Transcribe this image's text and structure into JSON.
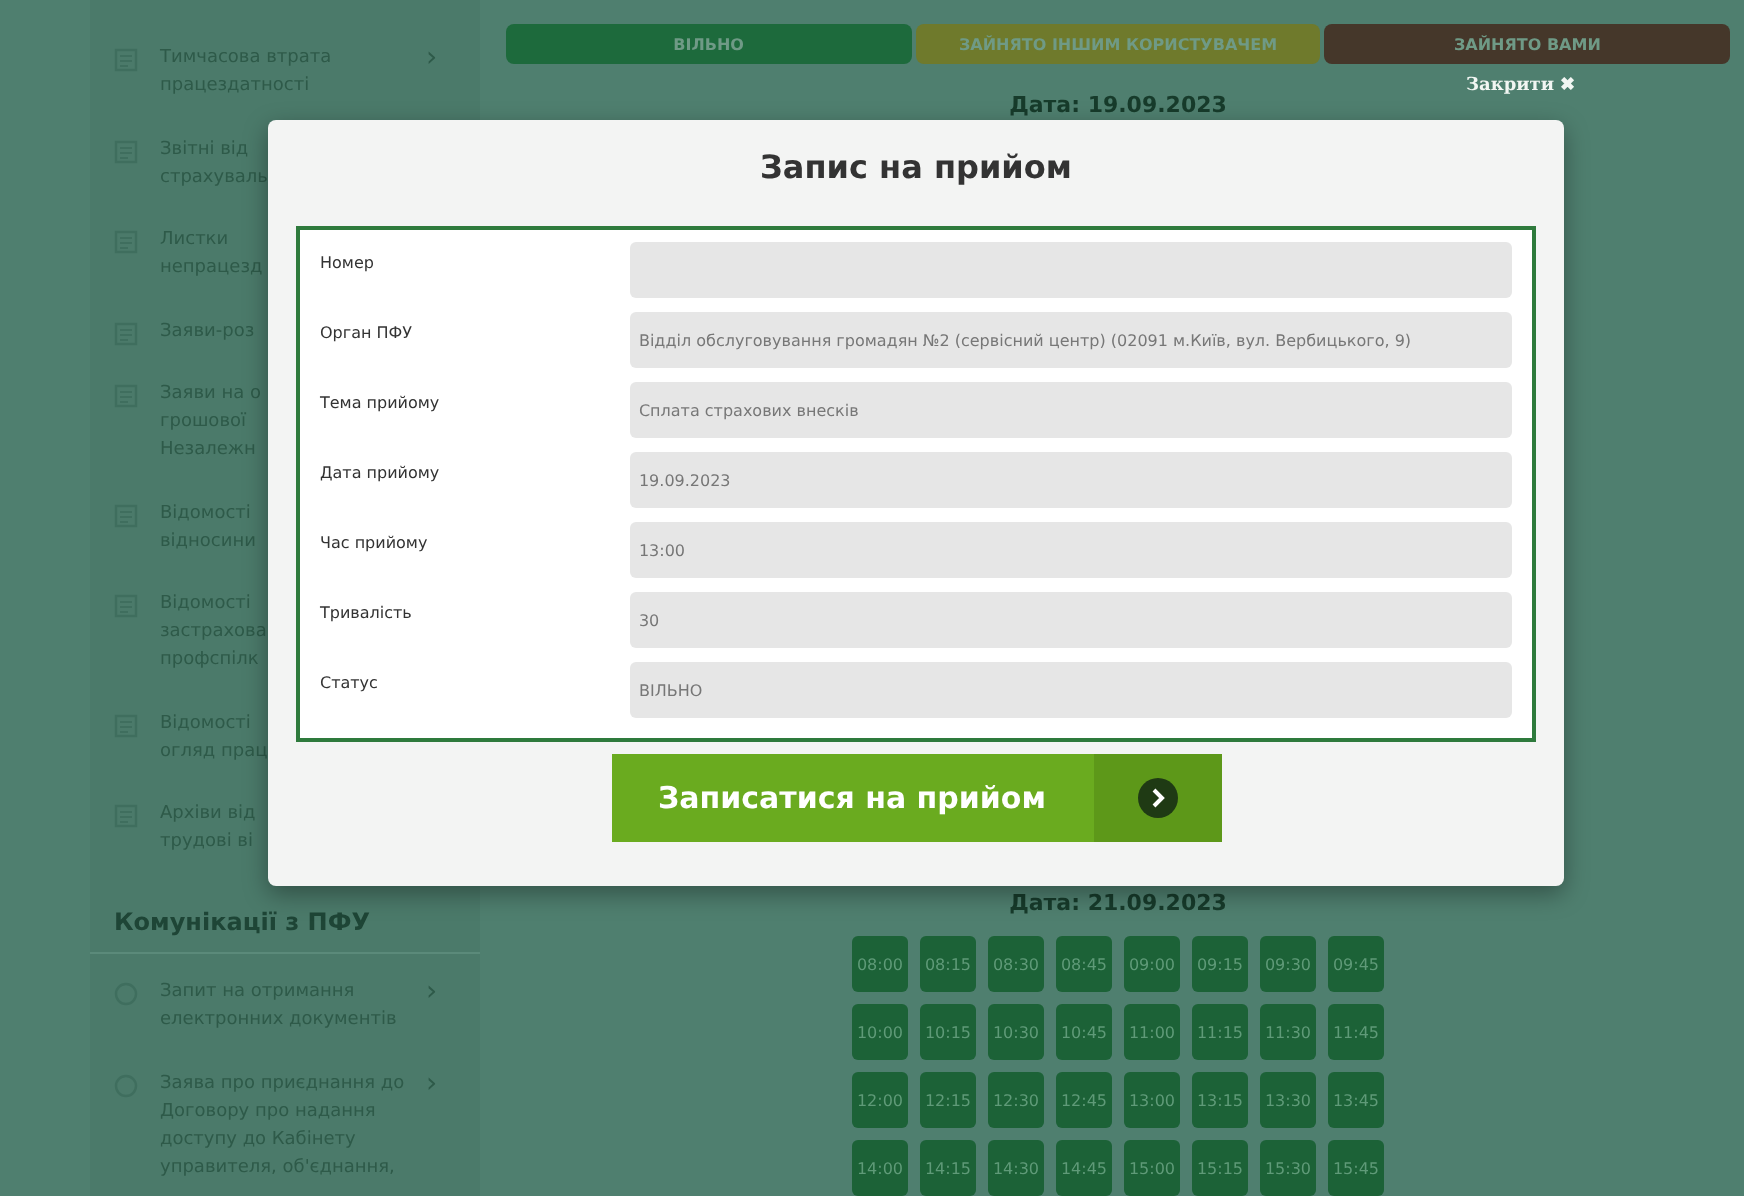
{
  "sidebar": {
    "items": [
      {
        "lines": [
          "Тимчасова втрата",
          "працездатності"
        ],
        "chevron": "›"
      },
      {
        "lines": [
          "Звітні від",
          "страхуваль"
        ]
      },
      {
        "lines": [
          "Листки",
          "непрацезд"
        ]
      },
      {
        "lines": [
          "Заяви-роз"
        ]
      },
      {
        "lines": [
          "Заяви на о",
          "грошової",
          "Незалежн"
        ]
      },
      {
        "lines": [
          "Відомості",
          "відносини"
        ]
      },
      {
        "lines": [
          "Відомості",
          "застрахова",
          "профспілк"
        ]
      },
      {
        "lines": [
          "Відомості",
          "огляд прац"
        ]
      },
      {
        "lines": [
          "Архіви від",
          "трудові ві"
        ]
      }
    ],
    "section_title": "Комунікації з ПФУ",
    "section_items": [
      {
        "lines": [
          "Запит на отримання",
          "електронних документів"
        ],
        "chevron": "›"
      },
      {
        "lines": [
          "Заява про приєднання до",
          "Договору про надання",
          "доступу до Кабінету",
          "управителя, об'єднання,"
        ],
        "chevron": "›"
      }
    ]
  },
  "legend": [
    {
      "label": "ВІЛЬНО",
      "color": "#1d6a3c"
    },
    {
      "label": "ЗАЙНЯТО ІНШИМ КОРИСТУВАЧЕМ",
      "color": "#6f7a2c"
    },
    {
      "label": "ЗАЙНЯТО ВАМИ",
      "color": "#45372a"
    }
  ],
  "top_date": "Дата: 19.09.2023",
  "close_label": "Закрити ✖",
  "modal": {
    "title": "Запис на прийом",
    "fields": [
      {
        "label": "Номер"
      },
      {
        "label": "Орган ПФУ",
        "value": "Відділ обслуговування громадян №2 (сервісний центр) (02091 м.Київ, вул. Вербицького, 9)"
      },
      {
        "label": "Тема прийому",
        "value": "Сплата страхових внесків"
      },
      {
        "label": "Дата прийому",
        "value": "19.09.2023"
      },
      {
        "label": "Час прийому",
        "value": "13:00"
      },
      {
        "label": "Тривалість",
        "value": "30"
      },
      {
        "label": "Статус",
        "value": "ВІЛЬНО"
      }
    ],
    "submit": "Записатися на прийом"
  },
  "schedule": {
    "date": "Дата: 21.09.2023",
    "slots": [
      "08:00",
      "08:15",
      "08:30",
      "08:45",
      "09:00",
      "09:15",
      "09:30",
      "09:45",
      "10:00",
      "10:15",
      "10:30",
      "10:45",
      "11:00",
      "11:15",
      "11:30",
      "11:45",
      "12:00",
      "12:15",
      "12:30",
      "12:45",
      "13:00",
      "13:15",
      "13:30",
      "13:45",
      "14:00",
      "14:15",
      "14:30",
      "14:45",
      "15:00",
      "15:15",
      "15:30",
      "15:45"
    ]
  }
}
